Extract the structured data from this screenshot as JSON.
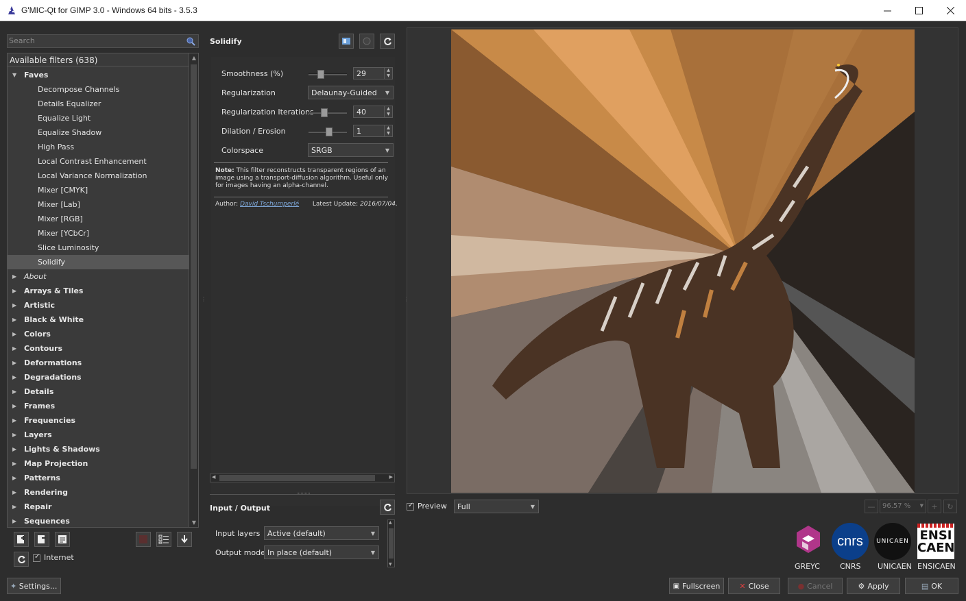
{
  "window": {
    "title": "G'MIC-Qt for GIMP 3.0 - Windows 64 bits - 3.5.3"
  },
  "search": {
    "placeholder": "Search"
  },
  "tree": {
    "header": "Available filters (638)",
    "faves_label": "Faves",
    "faves": [
      "Decompose Channels",
      "Details Equalizer",
      "Equalize Light",
      "Equalize Shadow",
      "High Pass",
      "Local Contrast Enhancement",
      "Local Variance Normalization",
      "Mixer [CMYK]",
      "Mixer [Lab]",
      "Mixer [RGB]",
      "Mixer [YCbCr]",
      "Slice Luminosity",
      "Solidify"
    ],
    "selected": "Solidify",
    "about": "About",
    "categories": [
      "Arrays & Tiles",
      "Artistic",
      "Black & White",
      "Colors",
      "Contours",
      "Deformations",
      "Degradations",
      "Details",
      "Frames",
      "Frequencies",
      "Layers",
      "Lights & Shadows",
      "Map Projection",
      "Patterns",
      "Rendering",
      "Repair",
      "Sequences"
    ]
  },
  "left_tools": {
    "internet_label": "Internet",
    "settings_label": "Settings..."
  },
  "filter": {
    "title": "Solidify",
    "params": {
      "smoothness_label": "Smoothness (%)",
      "smoothness_value": "29",
      "smoothness_frac": 0.29,
      "regularization_label": "Regularization",
      "regularization_value": "Delaunay-Guided",
      "iterations_label": "Regularization Iterations",
      "iterations_value": "40",
      "iterations_frac": 0.4,
      "dilation_label": "Dilation / Erosion",
      "dilation_value": "1",
      "dilation_frac": 0.55,
      "colorspace_label": "Colorspace",
      "colorspace_value": "SRGB"
    },
    "note_bold": "Note:",
    "note_text": " This filter reconstructs transparent regions of an image using a transport-diffusion algorithm. Useful only for images having an alpha-channel.",
    "author_label": "Author:",
    "author_name": "David Tschumperlé",
    "update_label": "Latest Update:",
    "update_value": "2016/07/04."
  },
  "io": {
    "title": "Input / Output",
    "input_layers_label": "Input layers",
    "input_layers_value": "Active (default)",
    "output_mode_label": "Output mode",
    "output_mode_value": "In place (default)"
  },
  "preview": {
    "label": "Preview",
    "mode_value": "Full",
    "zoom_value": "96.57 %"
  },
  "logos": {
    "greyc": "GREYC",
    "cnrs": "CNRS",
    "unicaen": "UNICAEN",
    "ensicaen": "ENSICAEN",
    "cnrs_mark": "cnrs",
    "unicaen_mark": "UNICAEN",
    "ensi_line1": "ENSI",
    "ensi_line2": "CAEN"
  },
  "buttons": {
    "fullscreen": "Fullscreen",
    "close": "Close",
    "cancel": "Cancel",
    "apply": "Apply",
    "ok": "OK"
  },
  "colors": {
    "bg": "#2d2d2d",
    "panel": "#3a3a3a",
    "selection": "#575757",
    "link": "#7fa8d9"
  }
}
